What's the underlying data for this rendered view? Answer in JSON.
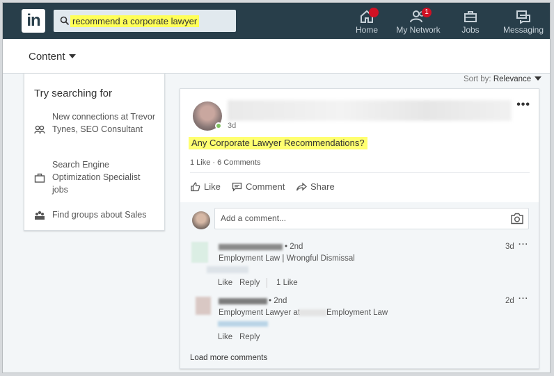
{
  "nav": {
    "logo_text": "in",
    "search_value": "recommend a corporate lawyer",
    "items": [
      {
        "label": "Home",
        "badge": ""
      },
      {
        "label": "My Network",
        "badge": "1"
      },
      {
        "label": "Jobs",
        "badge": ""
      },
      {
        "label": "Messaging",
        "badge": ""
      }
    ]
  },
  "filter": {
    "content_label": "Content"
  },
  "left_panel": {
    "title": "Try searching for",
    "suggestions": [
      {
        "text": "New connections at Trevor Tynes, SEO Consultant",
        "icon": "people-icon"
      },
      {
        "text": "Search Engine Optimization Specialist jobs",
        "icon": "briefcase-icon"
      },
      {
        "text": "Find groups about Sales",
        "icon": "groups-icon"
      }
    ]
  },
  "sort": {
    "label": "Sort by:",
    "value": "Relevance"
  },
  "post": {
    "age": "3d",
    "text": "Any Corporate Lawyer Recommendations?",
    "counts": "1 Like · 6 Comments",
    "actions": {
      "like": "Like",
      "comment": "Comment",
      "share": "Share"
    },
    "comment_placeholder": "Add a comment..."
  },
  "comments": [
    {
      "degree": "• 2nd",
      "headline": "Employment Law | Wrongful Dismissal",
      "age": "3d",
      "like": "Like",
      "reply": "Reply",
      "likes": "1 Like"
    },
    {
      "degree": "• 2nd",
      "headline_prefix": "Employment Lawyer at",
      "headline_suffix": "Employment Law",
      "age": "2d",
      "like": "Like",
      "reply": "Reply"
    }
  ],
  "load_more": "Load more comments",
  "colors": {
    "nav_bg": "#283e4a",
    "highlight": "#ffff57",
    "badge": "#d11124"
  }
}
